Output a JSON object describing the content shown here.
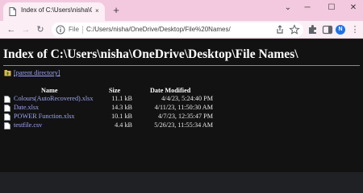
{
  "tab": {
    "title": "Index of C:\\Users\\nisha\\OneDrive",
    "close_glyph": "×",
    "new_tab_glyph": "+"
  },
  "window_controls": {
    "dropdown": "⌄",
    "minimize": "─",
    "maximize": "☐",
    "close": "✕"
  },
  "toolbar": {
    "back_glyph": "←",
    "forward_glyph": "→",
    "reload_glyph": "↻",
    "scheme_label": "File",
    "url": "C:/Users/nisha/OneDrive/Desktop/File%20Names/",
    "profile_initial": "N",
    "menu_glyph": "⋮"
  },
  "page": {
    "heading": "Index of C:\\Users\\nisha\\OneDrive\\Desktop\\File Names\\",
    "parent_link": "[parent directory]",
    "columns": {
      "name": "Name",
      "size": "Size",
      "date": "Date Modified"
    },
    "files": [
      {
        "name": "Colours(AutoRecovered).xlsx",
        "size": "11.1 kB",
        "date": "4/4/23, 5:24:40 PM"
      },
      {
        "name": "Date.xlsx",
        "size": "14.3 kB",
        "date": "4/11/23, 11:50:30 AM"
      },
      {
        "name": "POWER Function.xlsx",
        "size": "10.1 kB",
        "date": "4/7/23, 12:35:47 PM"
      },
      {
        "name": "testfile.csv",
        "size": "4.4 kB",
        "date": "5/26/23, 11:55:34 AM"
      }
    ]
  },
  "colors": {
    "tab_strip": "#f3c9df",
    "toolbar": "#fbeef5",
    "page_background": "#121212",
    "link": "#9ea4f5",
    "profile": "#1a73e8"
  },
  "icons": {
    "tab_favicon": "page-icon",
    "info": "info-icon",
    "share": "share-icon",
    "bookmark": "star-icon",
    "extensions": "puzzle-icon",
    "side_panel": "side-panel-icon",
    "parent_dir": "folder-up-icon",
    "file": "file-icon"
  }
}
